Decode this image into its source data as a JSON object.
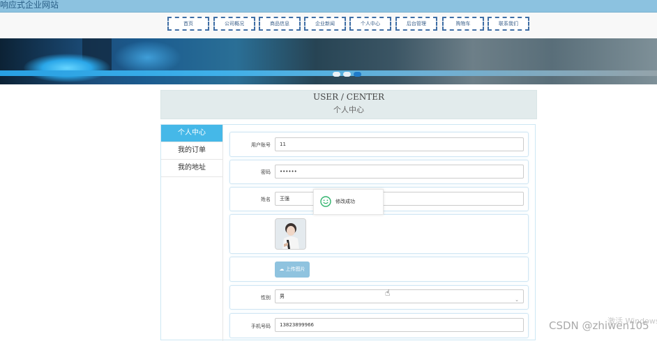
{
  "site": {
    "title": "响应式企业网站"
  },
  "nav": {
    "items": [
      "首页",
      "公司概况",
      "商品信息",
      "企业新闻",
      "个人中心",
      "后台管理",
      "购物车",
      "联系我们"
    ]
  },
  "carousel": {
    "active_index": 2,
    "count": 3
  },
  "user_center": {
    "title_en": "USER / CENTER",
    "title_cn": "个人中心"
  },
  "sidebar": {
    "items": [
      "个人中心",
      "我的订单",
      "我的地址"
    ],
    "active_index": 0
  },
  "form": {
    "account": {
      "label": "用户账号",
      "value": "11"
    },
    "password": {
      "label": "密码",
      "value": "••••••"
    },
    "name": {
      "label": "姓名",
      "value": "王强"
    },
    "upload": {
      "label": "上传图片"
    },
    "gender": {
      "label": "性别",
      "value": "男"
    },
    "phone": {
      "label": "手机号码",
      "value": "13823899966"
    }
  },
  "toast": {
    "message": "修改成功"
  },
  "watermarks": {
    "windows": "激活 Windows",
    "csdn": "CSDN @zhiwen105"
  },
  "colors": {
    "accent": "#45b8e8",
    "topbar": "#8cc2e0",
    "nav_border": "#3f6ea5"
  }
}
